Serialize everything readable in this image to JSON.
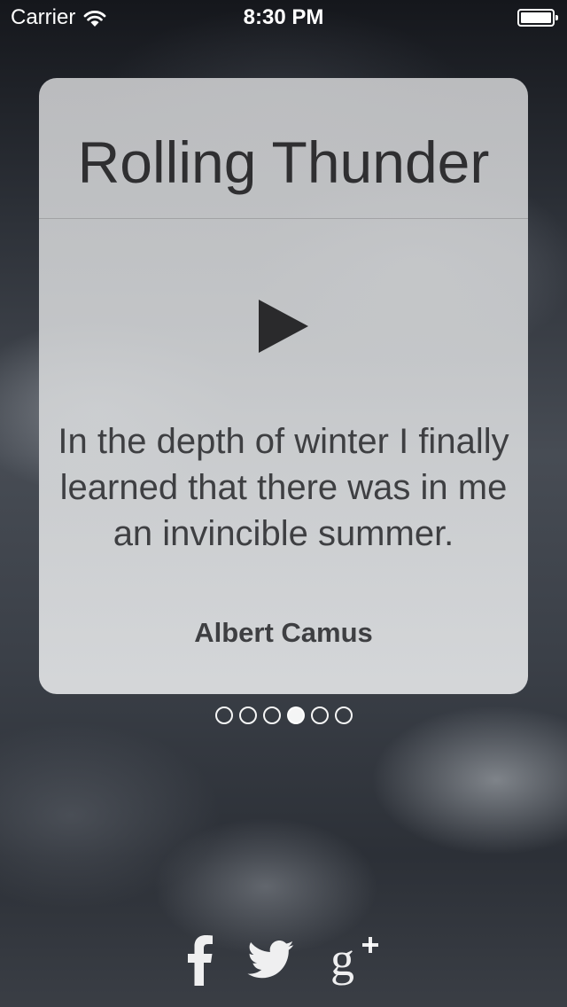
{
  "status_bar": {
    "carrier": "Carrier",
    "time": "8:30 PM"
  },
  "card": {
    "title": "Rolling Thunder",
    "quote": "In the depth of winter I finally learned that there was in me an invincible summer.",
    "author": "Albert Camus"
  },
  "page_indicator": {
    "total": 6,
    "current_index": 3
  },
  "social": {
    "icons": [
      "facebook-icon",
      "twitter-icon",
      "google-plus-icon"
    ]
  },
  "colors": {
    "card_text": "#3e3f42",
    "title_text": "#2f2f31",
    "indicator": "#ffffff"
  }
}
